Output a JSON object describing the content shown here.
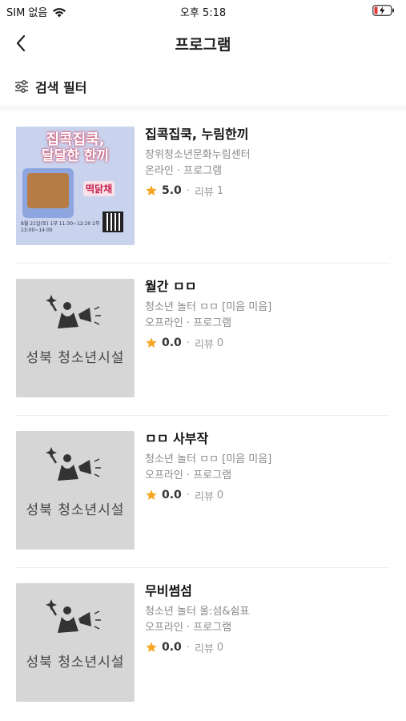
{
  "status_bar": {
    "carrier": "SIM 없음",
    "time": "오후 5:18"
  },
  "header": {
    "title": "프로그램"
  },
  "filter": {
    "label": "검색 필터"
  },
  "programs": [
    {
      "title": "집콕집쿡, 누림한끼",
      "org": "장위청소년문화누림센터",
      "meta": "온라인 · 프로그램",
      "rating": "5.0",
      "review_label": "리뷰",
      "review_count": "1",
      "poster": {
        "line1": "집콕집쿡,",
        "line2": "달달한 한끼",
        "badge": "떡닭채",
        "footer": "8월 21일(토) 1부 11:30~12:20 2부 13:00~14:00"
      }
    },
    {
      "title": "월간 ㅁㅁ",
      "org": "청소년 놀터 ㅁㅁ [미음 미음]",
      "meta": "오프라인 · 프로그램",
      "rating": "0.0",
      "review_label": "리뷰",
      "review_count": "0",
      "placeholder_text": "성북 청소년시설"
    },
    {
      "title": "ㅁㅁ 사부작",
      "org": "청소년 놀터 ㅁㅁ [미음 미음]",
      "meta": "오프라인 · 프로그램",
      "rating": "0.0",
      "review_label": "리뷰",
      "review_count": "0",
      "placeholder_text": "성북 청소년시설"
    },
    {
      "title": "무비썸섬",
      "org": "청소년 놀터 울:섬&쉼표",
      "meta": "오프라인 · 프로그램",
      "rating": "0.0",
      "review_label": "리뷰",
      "review_count": "0",
      "placeholder_text": "성북 청소년시설"
    }
  ],
  "icons": {
    "back": "chevron-left-icon",
    "filter": "sliders-icon",
    "star": "star-icon",
    "wifi": "wifi-icon",
    "battery": "battery-charging-icon"
  },
  "colors": {
    "star": "#f5a623",
    "text_secondary": "#8a8a8a",
    "placeholder_bg": "#d6d6d6"
  }
}
